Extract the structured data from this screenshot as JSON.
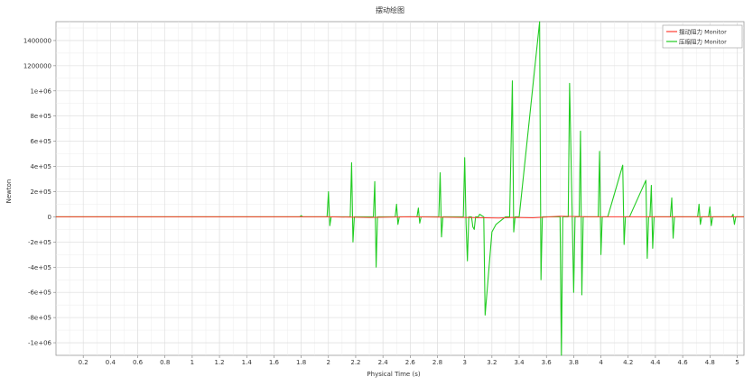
{
  "chart_data": {
    "type": "line",
    "title": "摆动绘图",
    "xlabel": "Physical Time (s)",
    "ylabel": "Newton",
    "xlim": [
      0,
      5.05
    ],
    "ylim": [
      -1100000,
      1550000
    ],
    "x_ticks": [
      0.2,
      0.4,
      0.6,
      0.8,
      1,
      1.2,
      1.4,
      1.6,
      1.8,
      2,
      2.2,
      2.4,
      2.6,
      2.8,
      3,
      3.2,
      3.4,
      3.6,
      3.8,
      4,
      4.2,
      4.4,
      4.6,
      4.8,
      5
    ],
    "x_tick_labels": [
      "0.2",
      "0.4",
      "0.6",
      "0.8",
      "1",
      "1.2",
      "1.4",
      "1.6",
      "1.8",
      "2",
      "2.2",
      "2.4",
      "2.6",
      "2.8",
      "3",
      "3.2",
      "3.4",
      "3.6",
      "3.8",
      "4",
      "4.2",
      "4.4",
      "4.6",
      "4.8",
      "5"
    ],
    "y_ticks": [
      1400000,
      1200000,
      1000000,
      800000,
      600000,
      400000,
      200000,
      0,
      -200000,
      -400000,
      -600000,
      -800000,
      -1000000
    ],
    "y_tick_labels": [
      "1400000",
      "1200000",
      "1e+06",
      "8e+05",
      "6e+05",
      "4e+05",
      "2e+05",
      "0",
      "-2e+05",
      "-4e+05",
      "-6e+05",
      "-8e+05",
      "-1e+06"
    ],
    "grid": true,
    "legend_position": "top-right",
    "series": [
      {
        "name": "摆动阻力 Monitor",
        "color": "#ff3b30",
        "x": [
          0,
          1.8,
          2.0,
          2.3,
          2.6,
          3.0,
          3.15,
          3.25,
          3.35,
          3.5,
          3.7,
          3.9,
          4.2,
          5.05
        ],
        "y": [
          0,
          0,
          0,
          -5000,
          0,
          -5000,
          -8000,
          -10000,
          -5000,
          -8000,
          5000,
          0,
          0,
          0
        ]
      },
      {
        "name": "压缩阻力 Monitor",
        "color": "#22cc22",
        "x": [
          0,
          1.79,
          1.8,
          1.81,
          1.99,
          2.0,
          2.01,
          2.02,
          2.03,
          2.16,
          2.17,
          2.18,
          2.19,
          2.2,
          2.33,
          2.34,
          2.35,
          2.36,
          2.49,
          2.5,
          2.51,
          2.52,
          2.65,
          2.66,
          2.67,
          2.68,
          2.81,
          2.82,
          2.83,
          2.84,
          2.85,
          2.99,
          3.0,
          3.01,
          3.02,
          3.03,
          3.05,
          3.06,
          3.07,
          3.08,
          3.1,
          3.11,
          3.14,
          3.15,
          3.2,
          3.21,
          3.22,
          3.23,
          3.3,
          3.33,
          3.35,
          3.36,
          3.37,
          3.38,
          3.39,
          3.4,
          3.55,
          3.56,
          3.57,
          3.58,
          3.59,
          3.6,
          3.7,
          3.71,
          3.72,
          3.73,
          3.74,
          3.75,
          3.76,
          3.77,
          3.8,
          3.81,
          3.82,
          3.83,
          3.84,
          3.85,
          3.86,
          3.87,
          3.98,
          3.99,
          4.0,
          4.01,
          4.02,
          4.03,
          4.04,
          4.05,
          4.16,
          4.17,
          4.18,
          4.19,
          4.2,
          4.21,
          4.33,
          4.34,
          4.35,
          4.36,
          4.37,
          4.38,
          4.39,
          4.5,
          4.51,
          4.52,
          4.53,
          4.54,
          4.55,
          4.7,
          4.71,
          4.72,
          4.73,
          4.74,
          4.79,
          4.8,
          4.81,
          4.82,
          4.83,
          4.84,
          4.85,
          4.95,
          4.96,
          4.97,
          4.98,
          4.99,
          5.05
        ],
        "y": [
          0,
          0,
          10000,
          0,
          0,
          200000,
          -70000,
          0,
          0,
          0,
          430000,
          -200000,
          0,
          0,
          0,
          280000,
          -400000,
          0,
          0,
          100000,
          -60000,
          0,
          0,
          70000,
          -50000,
          0,
          0,
          350000,
          -160000,
          0,
          0,
          0,
          470000,
          -50000,
          -350000,
          0,
          0,
          -80000,
          -100000,
          0,
          0,
          20000,
          0,
          -780000,
          -120000,
          -100000,
          -80000,
          -60000,
          0,
          0,
          1080000,
          -120000,
          0,
          0,
          0,
          0,
          1550000,
          -500000,
          0,
          0,
          0,
          0,
          0,
          -1100000,
          0,
          0,
          0,
          0,
          0,
          1060000,
          -600000,
          0,
          0,
          0,
          0,
          680000,
          -620000,
          0,
          0,
          520000,
          -300000,
          0,
          0,
          0,
          0,
          0,
          410000,
          -220000,
          0,
          0,
          0,
          0,
          290000,
          -330000,
          0,
          0,
          250000,
          -250000,
          0,
          0,
          0,
          150000,
          -170000,
          0,
          0,
          0,
          0,
          100000,
          -60000,
          0,
          0,
          80000,
          -70000,
          0,
          0,
          0,
          0,
          0,
          0,
          20000,
          -60000,
          0,
          0
        ]
      }
    ]
  }
}
